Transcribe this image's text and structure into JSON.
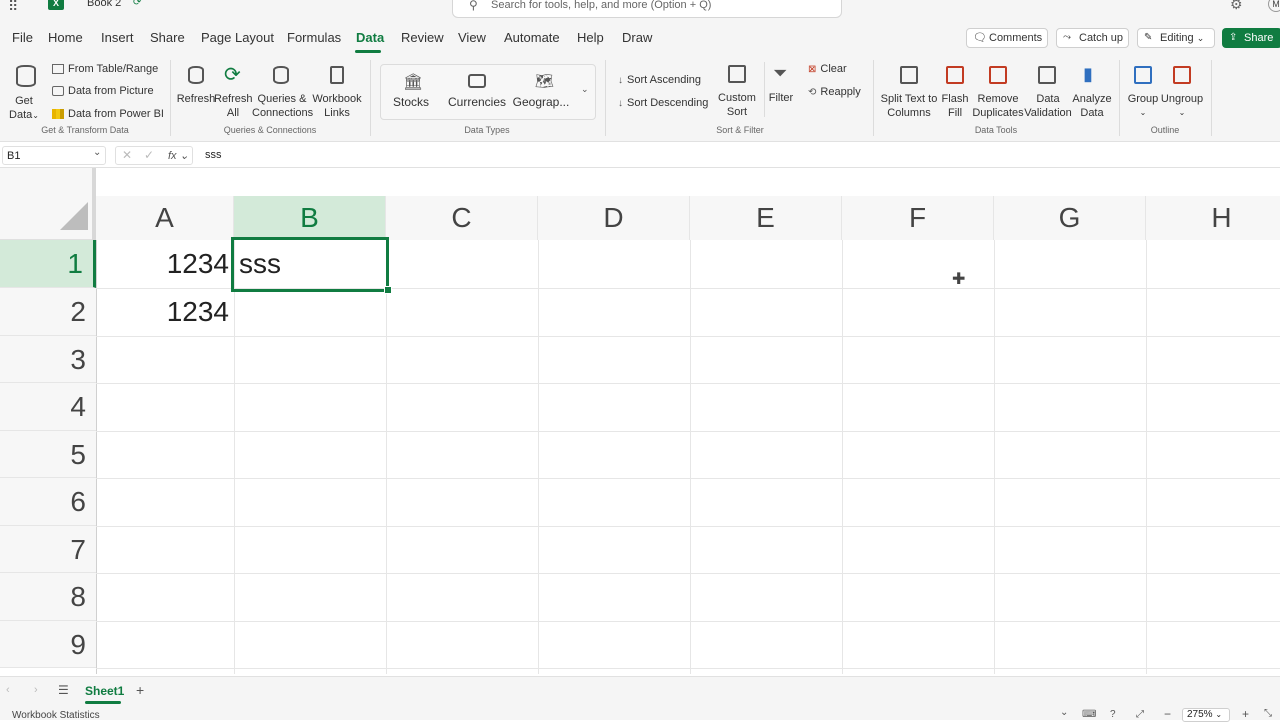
{
  "app": {
    "title": "Book 2",
    "search_placeholder": "Search for tools, help, and more (Option + Q)"
  },
  "menu": {
    "tabs": [
      "File",
      "Home",
      "Insert",
      "Share",
      "Page Layout",
      "Formulas",
      "Data",
      "Review",
      "View",
      "Automate",
      "Help",
      "Draw"
    ],
    "active_tab": "Data",
    "comments": "Comments",
    "catchup": "Catch up",
    "editing": "Editing",
    "share": "Share"
  },
  "ribbon": {
    "get_data": [
      "Get",
      "Data"
    ],
    "from_table": "From Table/Range",
    "from_picture": "Data from Picture",
    "from_powerbi": "Data from Power BI",
    "grp_get": "Get & Transform Data",
    "refresh": "Refresh",
    "refresh_all": [
      "Refresh",
      "All"
    ],
    "queries": [
      "Queries &",
      "Connections"
    ],
    "workbook_links": [
      "Workbook",
      "Links"
    ],
    "grp_queries": "Queries & Connections",
    "stocks": "Stocks",
    "currencies": "Currencies",
    "geography": "Geograp...",
    "grp_types": "Data Types",
    "sort_asc": "Sort Ascending",
    "sort_desc": "Sort Descending",
    "custom_sort": [
      "Custom",
      "Sort"
    ],
    "filter": "Filter",
    "clear": "Clear",
    "reapply": "Reapply",
    "grp_sort": "Sort & Filter",
    "split_text": [
      "Split Text to",
      "Columns"
    ],
    "flash_fill": [
      "Flash",
      "Fill"
    ],
    "remove_dup": [
      "Remove",
      "Duplicates"
    ],
    "data_validation": [
      "Data",
      "Validation"
    ],
    "analyze": [
      "Analyze",
      "Data"
    ],
    "grp_tools": "Data Tools",
    "group": "Group",
    "ungroup": "Ungroup",
    "grp_outline": "Outline"
  },
  "formula_bar": {
    "name_box": "B1",
    "fx": "fx",
    "value": "sss"
  },
  "grid": {
    "columns": [
      "A",
      "B",
      "C",
      "D",
      "E",
      "F",
      "G",
      "H"
    ],
    "rows": [
      "1",
      "2",
      "3",
      "4",
      "5",
      "6",
      "7",
      "8",
      "9"
    ],
    "cells": {
      "A1": "1234",
      "B1": "sss",
      "A2": "1234"
    },
    "selected": "B1"
  },
  "sheets": {
    "active": "Sheet1"
  },
  "status": {
    "left": "Workbook Statistics",
    "zoom": "275%"
  },
  "colors": {
    "accent": "#107c41",
    "selected_header_bg": "#d3ead9"
  }
}
